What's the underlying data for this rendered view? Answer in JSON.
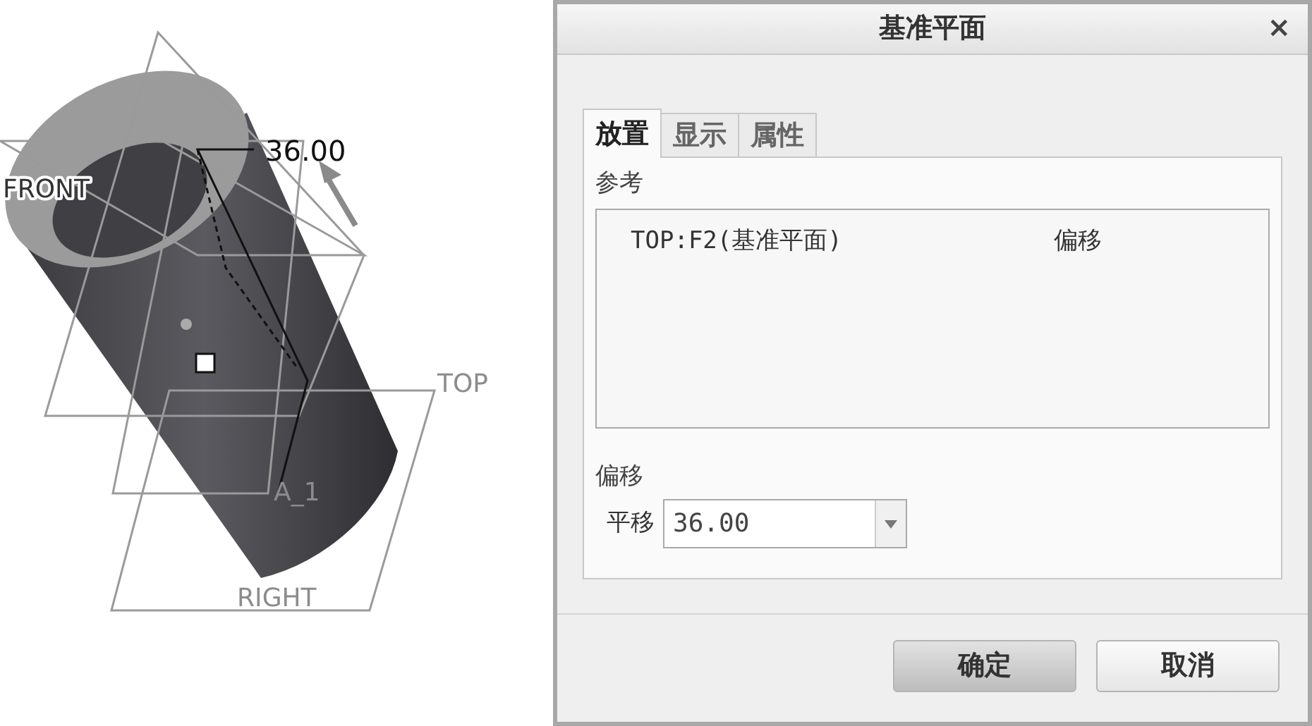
{
  "viewport": {
    "dimension": "36.00",
    "planes": [
      "FRONT",
      "TOP",
      "RIGHT"
    ],
    "axis": "A_1"
  },
  "dialog": {
    "title": "基准平面",
    "close": "×",
    "tabs": [
      {
        "label": "放置",
        "selected": true
      },
      {
        "label": "显示",
        "selected": false
      },
      {
        "label": "属性",
        "selected": false
      }
    ],
    "references_label": "参考",
    "references": [
      {
        "name": "TOP:F2(基准平面)",
        "constraint": "偏移"
      }
    ],
    "offset_label": "偏移",
    "offset_field": {
      "label": "平移",
      "value": "36.00"
    },
    "buttons": [
      {
        "label": "确定",
        "default": true
      },
      {
        "label": "取消",
        "default": false
      }
    ]
  }
}
